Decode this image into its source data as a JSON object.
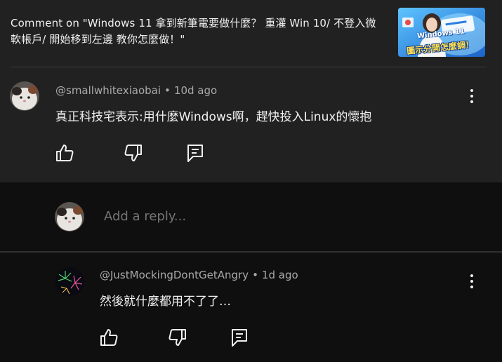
{
  "header": {
    "title": "Comment on \"Windows 11 拿到新筆電要做什麼？ 重灌 Win 10/ 不登入微軟帳戶/ 開始移到左邊 教你怎麼做！\"",
    "thumbnail": {
      "line1": "Windows 11",
      "line2": "圖示分開怎麼調！"
    }
  },
  "comment": {
    "author": "@smallwhitexiaobai",
    "separator": "•",
    "time": "10d ago",
    "text": "真正科技宅表示:用什麼Windows啊，趕快投入Linux的懷抱"
  },
  "reply_box": {
    "placeholder": "Add a reply..."
  },
  "reply": {
    "author": "@JustMockingDontGetAngry",
    "separator": "•",
    "time": "1d ago",
    "text": "然後就什麼都用不了了…"
  },
  "colors": {
    "top_bg": "#212121",
    "page_bg": "#0f0f0f",
    "text": "#f1f1f1",
    "muted": "#aaaaaa"
  }
}
